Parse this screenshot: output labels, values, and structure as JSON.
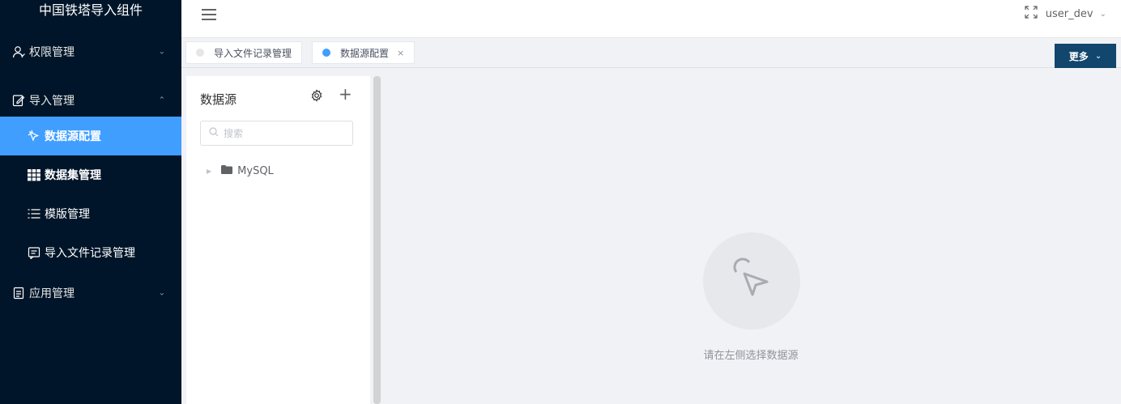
{
  "app": {
    "title": "中国铁塔导入组件"
  },
  "sidebar": {
    "groups": [
      {
        "label": "权限管理",
        "icon": "user-icon",
        "expanded": false
      },
      {
        "label": "导入管理",
        "icon": "edit-doc-icon",
        "expanded": true,
        "items": [
          {
            "label": "数据源配置",
            "icon": "cursor-icon",
            "active": true
          },
          {
            "label": "数据集管理",
            "icon": "grid-icon",
            "active": false
          },
          {
            "label": "模版管理",
            "icon": "list-icon",
            "active": false
          },
          {
            "label": "导入文件记录管理",
            "icon": "file-record-icon",
            "active": false
          }
        ]
      },
      {
        "label": "应用管理",
        "icon": "doc-icon",
        "expanded": false
      }
    ]
  },
  "header": {
    "user": "user_dev"
  },
  "tabs": [
    {
      "label": "导入文件记录管理",
      "active": false,
      "closable": false
    },
    {
      "label": "数据源配置",
      "active": true,
      "closable": true,
      "close_glyph": "×"
    }
  ],
  "more_button": {
    "label": "更多"
  },
  "datasource_panel": {
    "title": "数据源",
    "search_placeholder": "搜索",
    "tree": [
      {
        "label": "MySQL",
        "expanded": false
      }
    ]
  },
  "main": {
    "empty_text": "请在左侧选择数据源"
  },
  "colors": {
    "sidebar_bg": "#001529",
    "active_item": "#409eff",
    "more_button": "#12466c",
    "active_dot": "#409eff"
  }
}
